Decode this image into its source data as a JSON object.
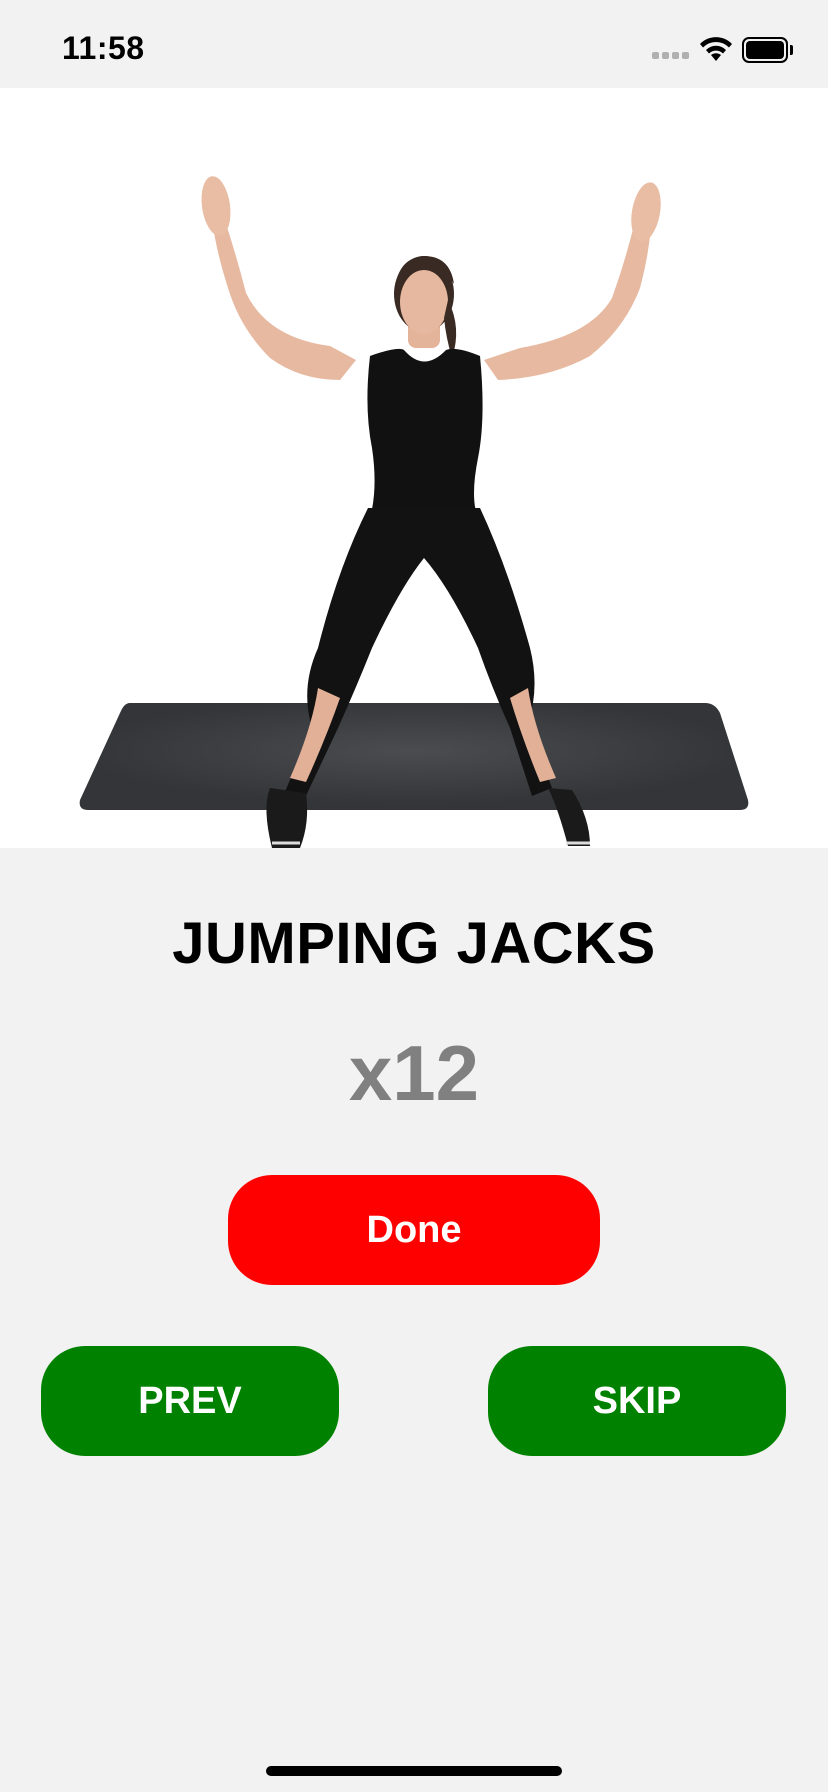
{
  "status_bar": {
    "time": "11:58",
    "signal_icon": "cellular-signal-icon",
    "wifi_icon": "wifi-icon",
    "battery_icon": "battery-icon"
  },
  "exercise": {
    "image_icon": "jumping-jacks-illustration",
    "name": "JUMPING JACKS",
    "reps": "x12"
  },
  "buttons": {
    "done_label": "Done",
    "prev_label": "PREV",
    "skip_label": "SKIP"
  },
  "colors": {
    "background": "#f2f2f2",
    "done": "#ff0000",
    "nav": "#008200",
    "reps_text": "#808080"
  }
}
